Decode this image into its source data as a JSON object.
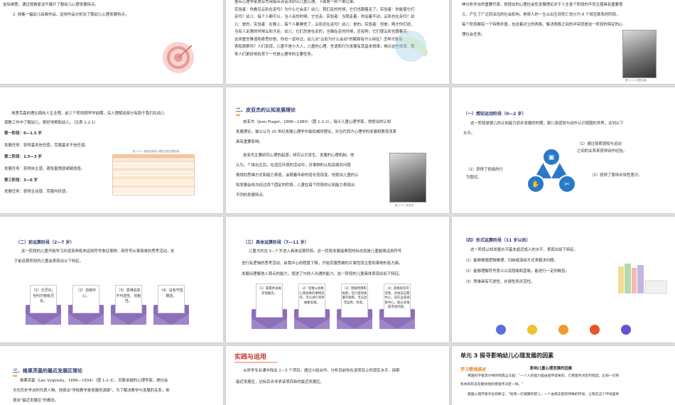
{
  "slide1": {
    "line1": "友际继登。通过观看家试不展片了解幼儿心理发展特点。",
    "line2": "2. 收集一幅幼儿绘画作品，运用作品分析法了解幼儿心理发展特点。"
  },
  "slide2": {
    "lines": [
      "著名心理学家皮亚杰用临床谈话法研究儿童心理，下面是一则个案记录。",
      "实验者：你看见云彩在走吗？为什么它会走？幼儿：我们走的时候，它们也跟着走了。实验者：你能使它们",
      "走吗？幼儿：每个人都可以，当人走的时候，它也走。实验者：当我走着，你站着不动，云彩也在走吗？幼",
      "儿：是的。实验者：在晚上，每个人都睡觉了，云彩还在走吗？幼儿：是的。实验者：但是，刚才你们说，",
      "当有人走路的时候云彩才走。幼儿：它们总是在走的，当猫在走的时候，还有狗，它们使云彩也跟着走。",
      "这类童言稚语和奇思妙想，你也一定听过。幼儿对\"云彩为什么会动\"的解释有什么特征？怎样才能有",
      "表和观察吗？人们发现，儿童不是小大人，儿童的心理、言语和行为发展有其基本规律，揭示这些规律，我",
      "导人们更好地抚育下一代是心理学的主要任务。"
    ]
  },
  "slide3": {
    "lines": [
      "伸分析学派的重要代表。他提出的心理社会性发展理论对于人生各个阶段的不同主题具有重要意",
      "义，产生了广泛而深远的社会影响。他将人的一生从出生到死亡划分为 8 个相互联系的阶段，",
      "每个阶段都有一个特殊矛盾，包含着对立的两极，解决两极之间的冲突就是这一阶段的特定的心",
      "理社会任务。"
    ],
    "caption": "图 1-2-1 埃里克森"
  },
  "slide4": {
    "intro1": "埃里克森的理论面向人生全程，前三个阶段稍早学前期，深入理解这部分有助于我们在幼儿",
    "intro2": "保教工作中了解幼儿，更好地帮助幼儿。（见表 1-2-1）",
    "stage1": "第一阶段：0—1.5 岁",
    "task1": "发展任务：获得基本信任感，克服基本不信任感。",
    "stage2": "第二阶段：1.5—3 岁",
    "task2": "发展任务：获得自主感、避免羞愧感或疑虑感。",
    "stage3": "第三阶段：3—6 岁",
    "task3": "发展任务：获得主动感、克服内疚感。",
    "table_caption": "表 1-2-1 埃里克森的心理社会性发展阶段"
  },
  "slide5": {
    "heading": "二、皮亚杰的认知发展理论",
    "lines": [
      "皮亚杰（Jean Piaget，1896—1980）（图 1-2-2），瑞士儿童心理学家，他提出的认知",
      "发展理论，被公认为 20 世纪发展心理学中最权威的理论，对当代西方心理学的发展和教育改革",
      "具有重要影响。",
      "皮亚杰主要研究心理的起源，研究认识发生、发展的心理机制。他",
      "认为，个体出生后，在适应环境的活动中，对事物的认知及面对问题",
      "情境的思维方式和能力表现，会随着年龄的增长而改变。他提出儿童的认",
      "知发展会依次经过四个固定的阶段，儿童在每个阶段的认知能力表现出",
      "不同的发展特点。"
    ],
    "caption": "图 1-2-2 皮亚杰"
  },
  "slide6": {
    "heading": "（一）感知运动阶段（0—2 岁）",
    "line1": "这一阶段是婴儿的认知能力初步发展的时期，婴儿靠感觉与动作认识周围的世界，达到以下",
    "line2": "水平。",
    "point1_a": "（1）通过探索感知与运动",
    "point1_b": "之间的关系来获得动作经验。",
    "point2_a": "（2）获得了低级的行",
    "point2_b": "为图式。",
    "point3": "（3）获得了客体永恒性意识。"
  },
  "slide7": {
    "heading": "（二）前运算阶段（2—7 岁）",
    "line1": "这一阶段的儿童开始学习并逐渐熟练地运用符号象征事物、用符号从事简单的思考活动，处",
    "line2": "于前运算阶段的儿童会表现出以下特征。",
    "cards": [
      "（1）泛灵论，也叫万物有灵论。",
      "（2）自我中心。",
      "（3）思维具有不可逆性、刻板性。",
      "（4）没有守恒概念。"
    ]
  },
  "slide8": {
    "heading": "（三）具体运算阶段（7—11 岁）",
    "lines": [
      "儿童大约在 5—7 岁进入具体运算阶段。这一阶段发展最典型的标志就是儿童能够运用符号",
      "进行有逻辑的思考活动，自我中心的程度下降，开始克服思维的片面性而注意到事物的各方面。",
      "发展出理解他人观点的能力，增进了与他人沟通的能力。这一阶段的儿童具体表现出如下特征。"
    ],
    "cards": [
      "（1）掌握并发展守恒概念。",
      "（2）思维以具象心理表象的事物支持，可以进行简单抽象思维。",
      "（3）理解原则和规则，但只能刻板遵守规则，无法灵活运用，改变。",
      "（4）思维具有可逆性，开始去自我中心，还在自身视角中心，能从多角度考虑问题。"
    ]
  },
  "slide9": {
    "heading": "（四）形式运算阶段（11 岁以后）",
    "line1": "这一阶段认知发展水平基本趋近成人的水平，表现出如下特征。",
    "points": [
      "（1）能够根据逻辑推理、归纳或演绎方式来解决问题。",
      "（2）能够理解符号意义以及隐喻和直喻，能进行一定的概括。",
      "（3）思维具有可逆性、补偿性和灵活性。"
    ]
  },
  "slide10": {
    "heading": "三、维果茨基的最近发展区理论",
    "lines": [
      "维果茨基（Lev Vygotsky，1896—1934）（图 1-2-3），苏联卓越的心理学家，是社会",
      "文化历史学派的代表人物。他提出\"学校教学是发展的源泉\"。为了解决教学与发展的关系，他",
      "提出\"最近发展区\"的概念。"
    ]
  },
  "slide11": {
    "heading": "实践与运用",
    "line1": "从所学专业课中找出 1—3 个项目，通过小组合作，分析目前你在该项目上的现实水平，探索",
    "line2": "最近发展区，达标后去寻求该项目新的最近发展区。"
  },
  "slide12": {
    "unit": "单元 3  探寻影响幼儿心理发展的因素",
    "sub_heading": "学习情境描述",
    "sub_title": "影响儿童心理发展的因素",
    "lines": [
      "英国科学家高尔顿的经典言论是：\"一个人的能力是由遗传得来的，它受遗传决定的程度，正如一切有",
      "机体的形态及躯体组织受遗传决定一样。\"",
      "美国心理学家华生则断言：\"给我一打健康的婴儿，一个由我支配的特殊的环境，让我在这个环境里养"
    ]
  },
  "colors": {
    "title_blue": "#2f3b70",
    "accent_orange": "#f0a040",
    "envelope_purple": "#8b6fb8",
    "triangle_blue": "#2a78c8",
    "practice_red": "#c0392b"
  }
}
